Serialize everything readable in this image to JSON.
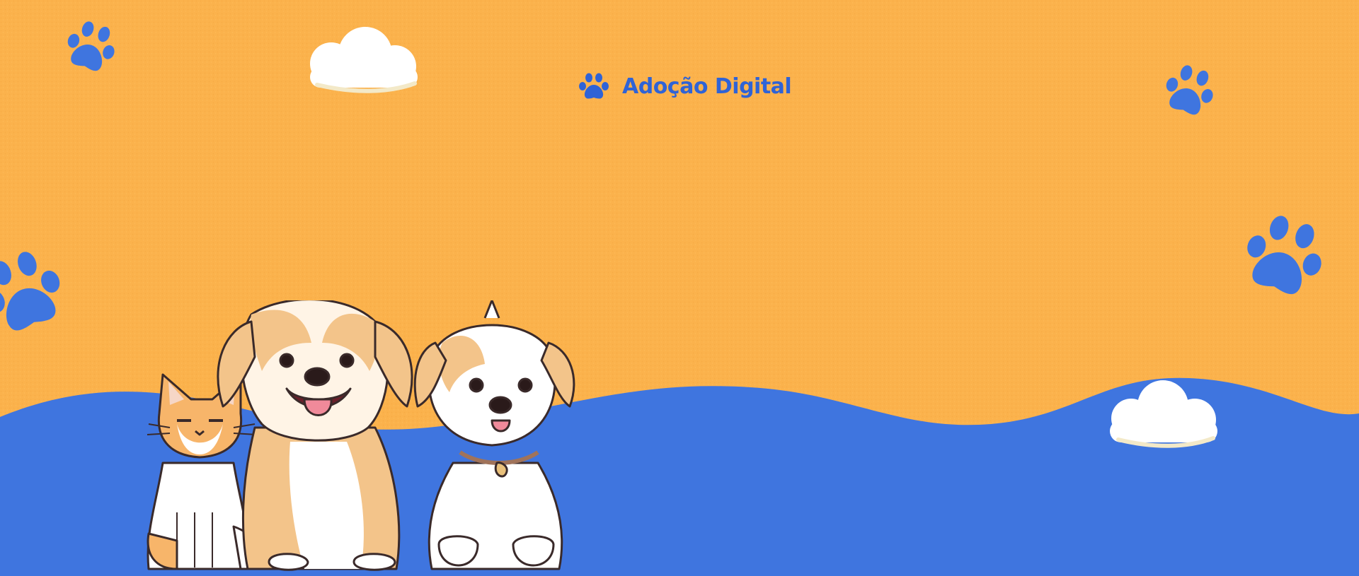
{
  "brand": {
    "name": "Adoção Digital"
  },
  "colors": {
    "background": "#FBB24C",
    "wave": "#3F75DF",
    "paw": "#3F75DF",
    "brand_text": "#2F63D6",
    "cloud": "#FFFFFF",
    "outline": "#3A2A2A"
  },
  "decorations": {
    "icons": [
      "paw-print-icon",
      "cloud-icon",
      "cat-illustration",
      "dog-illustration",
      "puppy-illustration"
    ]
  }
}
